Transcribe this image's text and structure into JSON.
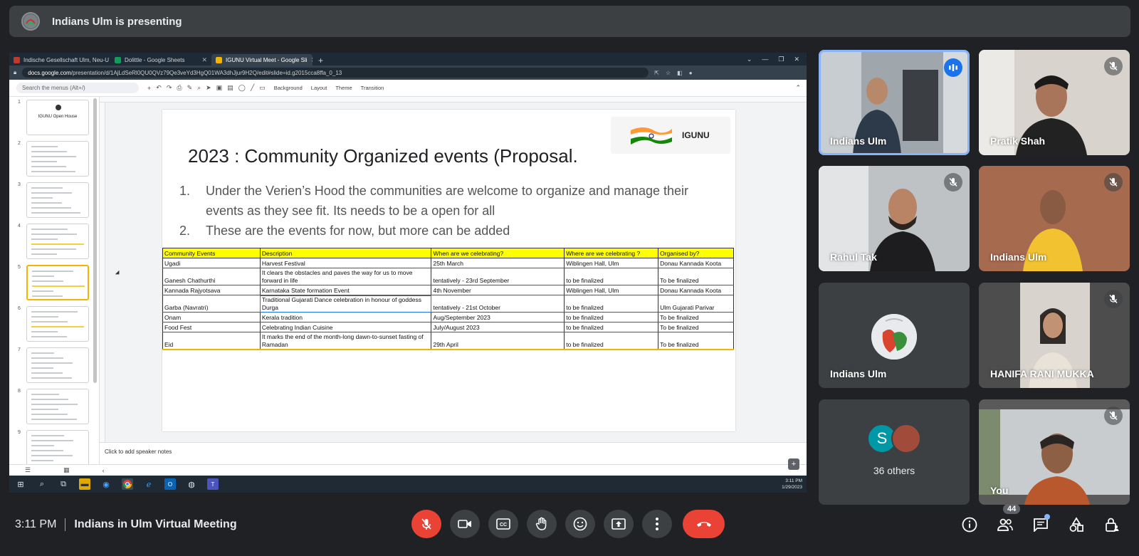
{
  "banner": {
    "text": "Indians Ulm is presenting"
  },
  "browser": {
    "tabs": [
      {
        "label": "Indische Gesellschaft Ulm, Neu-U",
        "color": "#c0392b"
      },
      {
        "label": "Dolittle - Google Sheets",
        "color": "#0f9d58"
      },
      {
        "label": "IGUNU Virtual Meet - Google Sli",
        "color": "#f4b400"
      }
    ],
    "url_host": "docs.google.com",
    "url_path": "/presentation/d/1AjLdSeRl0QU0QVz79Qe3veYd3HgQ01WA3dhJjur9H2Q/edit#slide=id.g2015cca8ffa_0_13"
  },
  "slides_app": {
    "search_placeholder": "Search the menus (Alt+/)",
    "toolbar": {
      "background": "Background",
      "layout": "Layout",
      "theme": "Theme",
      "transition": "Transition"
    },
    "speaker_notes": "Click to add speaker notes",
    "thumb_numbers": [
      "1",
      "2",
      "3",
      "4",
      "5",
      "6",
      "7",
      "8",
      "9"
    ],
    "thumb1_title": "IGUNU Open House",
    "slide": {
      "logo_text": "IGUNU",
      "title": "2023 : Community Organized events (Proposal.",
      "bullets": [
        {
          "n": "1.",
          "text": "Under the Verien’s Hood the communities are welcome to organize and manage their events as they see fit. Its needs to be a open for all"
        },
        {
          "n": "2.",
          "text": "These are the events for now, but more can be added"
        }
      ],
      "table": {
        "headers": [
          "Community Events",
          "Description",
          "When are we celebrating?",
          "Where are we celebrating ?",
          "Organised by?"
        ],
        "rows": [
          {
            "c0": "Ugadi",
            "c1": "Harvest Festival",
            "c2": "25th March",
            "c3": "Wiblingen Hall, Ulm",
            "c4": "Donau Kannada Koota",
            "tall": false
          },
          {
            "c0": "Ganesh Chathurthi",
            "c1": "It clears the obstacles and paves the way for us to move forward in life",
            "c2": "tentatively - 23rd September",
            "c3": "to be finalized",
            "c4": "To be finalized",
            "tall": true
          },
          {
            "c0": "Kannada Rajyotsava",
            "c1": "Karnataka State formation Event",
            "c2": "4th November",
            "c3": "Wiblingen Hall, Ulm",
            "c4": "Donau Kannada Koota",
            "tall": false
          },
          {
            "c0": "Garba (Navratri)",
            "c1": "Traditional Gujarati Dance celebration in honour of goddess Durga",
            "c2": "tentatively - 21st October",
            "c3": "to be finalized",
            "c4": "Ulm Gujarati Parivar",
            "tall": true
          },
          {
            "c0": "Onam",
            "c1": "Kerala tradition",
            "c2": "Aug/September 2023",
            "c3": "to be finalized",
            "c4": "To be finalized",
            "tall": false
          },
          {
            "c0": "Food Fest",
            "c1": "Celebrating Indian Cuisine",
            "c2": "July/August 2023",
            "c3": "to be finalized",
            "c4": "To be finalized",
            "tall": false
          },
          {
            "c0": "Eid",
            "c1": "It marks the end of the month-long dawn-to-sunset fasting of Ramadan",
            "c2": "29th April",
            "c3": "to be finalized",
            "c4": "To be finalized",
            "tall": true
          }
        ]
      }
    }
  },
  "taskbar": {
    "time": "3:11 PM",
    "date": "1/29/2023"
  },
  "participants": [
    {
      "name": "Indians Ulm",
      "state": "speaking"
    },
    {
      "name": "Pratik Shah",
      "state": "muted"
    },
    {
      "name": "Rahul Tak",
      "state": "muted"
    },
    {
      "name": "Indians Ulm",
      "state": "muted"
    },
    {
      "name": "Indians Ulm",
      "state": "muted"
    },
    {
      "name": "HANIFA RANI MUKKA",
      "state": "muted"
    },
    {
      "name": "You",
      "state": "muted"
    }
  ],
  "others": {
    "initial": "S",
    "label": "36 others"
  },
  "meeting": {
    "time": "3:11 PM",
    "title": "Indians in Ulm Virtual Meeting",
    "participant_count": "44"
  },
  "colors": {
    "end_call": "#ea4335",
    "accent": "#8ab4f8",
    "speaking": "#1a73e8"
  }
}
